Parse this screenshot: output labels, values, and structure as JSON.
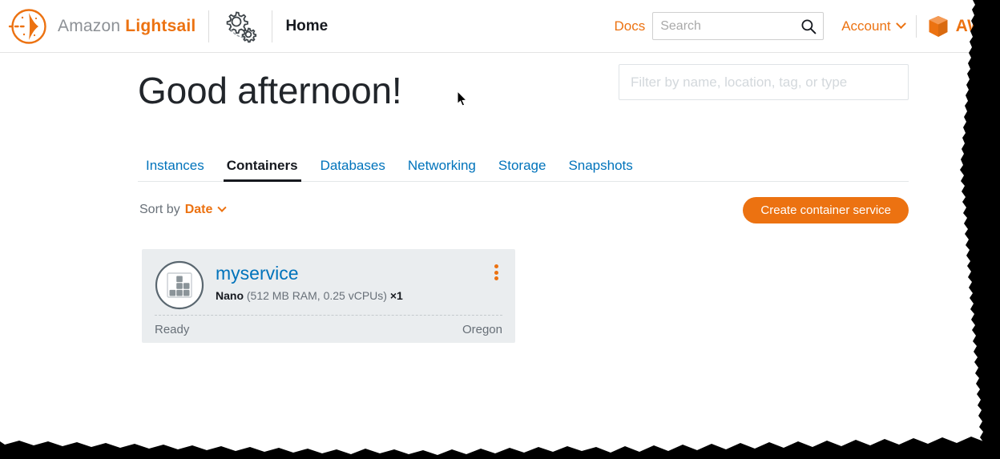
{
  "header": {
    "logo_icon": "lightsail-logo-icon",
    "brand_amazon": "Amazon",
    "brand_lightsail": "Lightsail",
    "gears_icon": "gears-icon",
    "home_label": "Home",
    "docs_label": "Docs",
    "search": {
      "value": "",
      "placeholder": "Search",
      "icon": "search-icon"
    },
    "account_label": "Account",
    "account_chevron_icon": "chevron-down-icon",
    "aws_cube_icon": "aws-cube-icon",
    "aws_label": "AWS"
  },
  "main": {
    "greeting": "Good afternoon!",
    "filter": {
      "value": "",
      "placeholder": "Filter by name, location, tag, or type"
    },
    "tabs": [
      {
        "label": "Instances",
        "active": false
      },
      {
        "label": "Containers",
        "active": true
      },
      {
        "label": "Databases",
        "active": false
      },
      {
        "label": "Networking",
        "active": false
      },
      {
        "label": "Storage",
        "active": false
      },
      {
        "label": "Snapshots",
        "active": false
      }
    ],
    "sort": {
      "prefix": "Sort by",
      "value": "Date",
      "chevron_icon": "chevron-down-icon"
    },
    "create_button": "Create container service",
    "cards": [
      {
        "icon": "container-service-icon",
        "name": "myservice",
        "power": "Nano",
        "specs": "(512 MB RAM, 0.25 vCPUs)",
        "scale": "×1",
        "status": "Ready",
        "region": "Oregon",
        "menu_icon": "kebab-menu-icon"
      }
    ]
  },
  "colors": {
    "accent_orange": "#ec7211",
    "link_blue": "#0073bb",
    "text_dark": "#16191f",
    "text_gray": "#687078",
    "card_bg": "#eaedef"
  }
}
